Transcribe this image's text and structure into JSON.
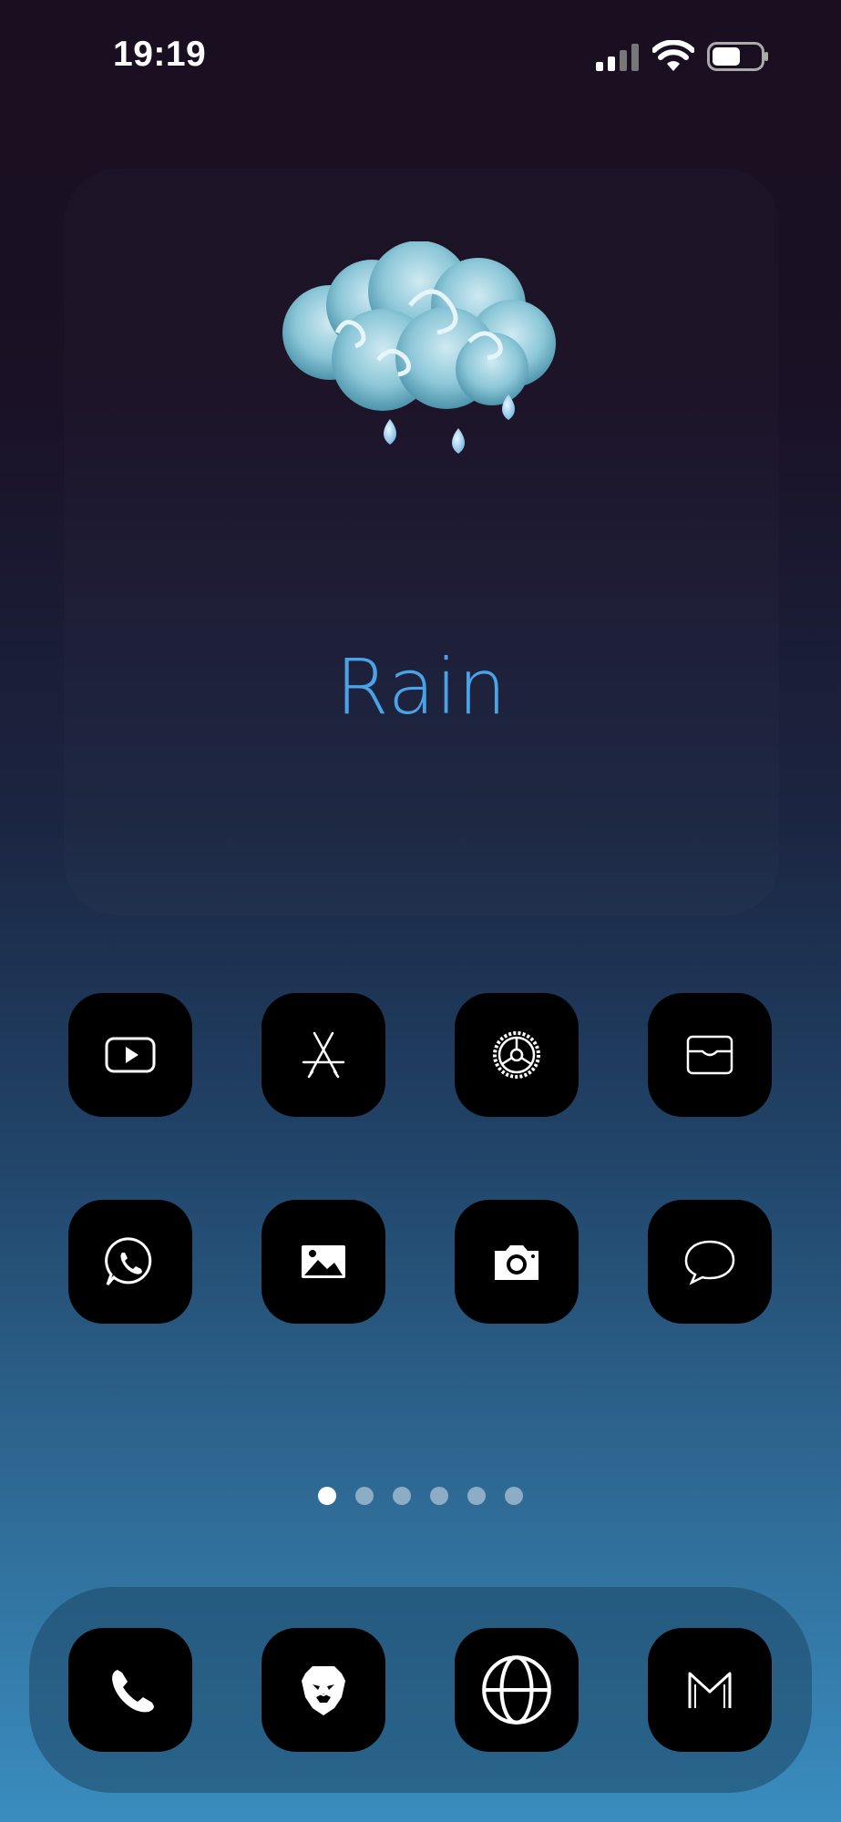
{
  "status_bar": {
    "time": "19:19",
    "signal_icon": "cellular-signal-icon",
    "wifi_icon": "wifi-icon",
    "battery_icon": "battery-icon"
  },
  "weather_widget": {
    "condition": "Rain",
    "icon": "rain-cloud-icon",
    "accent_color": "#4aa3e8"
  },
  "home_apps": [
    {
      "icon": "youtube-icon"
    },
    {
      "icon": "app-store-icon"
    },
    {
      "icon": "settings-gear-icon"
    },
    {
      "icon": "wallet-icon"
    },
    {
      "icon": "whatsapp-icon"
    },
    {
      "icon": "photos-icon"
    },
    {
      "icon": "camera-icon"
    },
    {
      "icon": "messages-icon"
    }
  ],
  "page_indicator": {
    "total_pages": 6,
    "current_page": 1
  },
  "dock_apps": [
    {
      "icon": "phone-icon"
    },
    {
      "icon": "brave-lion-icon"
    },
    {
      "icon": "globe-browser-icon"
    },
    {
      "icon": "gmail-icon"
    }
  ]
}
